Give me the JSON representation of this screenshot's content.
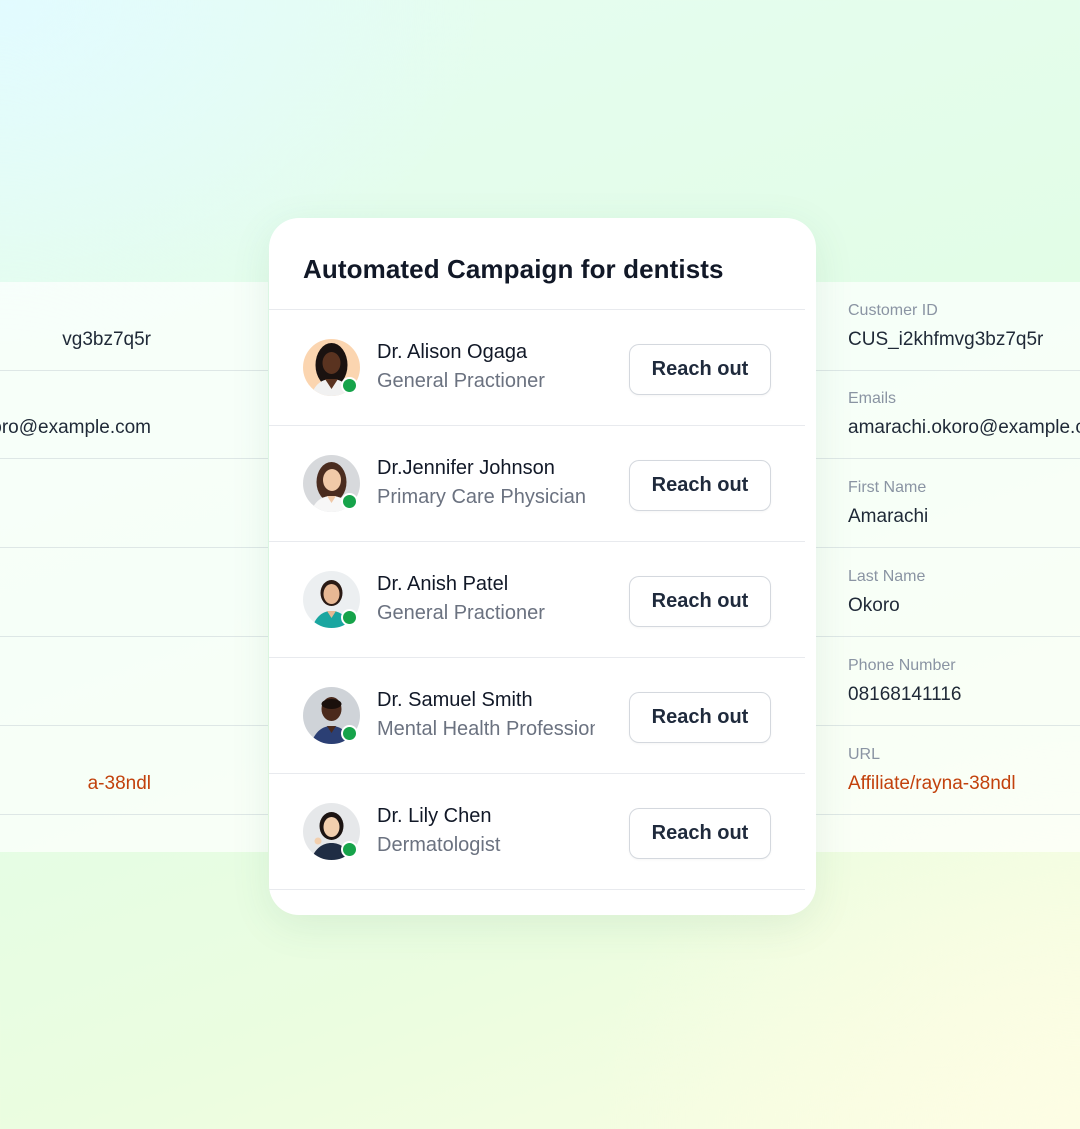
{
  "background_record": {
    "left_values": [
      "vg3bz7q5r",
      "oro@example.com",
      "",
      "",
      "",
      "a-38ndl"
    ],
    "right_fields": [
      {
        "label": "Customer ID",
        "value": "CUS_i2khfmvg3bz7q5r"
      },
      {
        "label": "Emails",
        "value": "amarachi.okoro@example.c"
      },
      {
        "label": "First Name",
        "value": "Amarachi"
      },
      {
        "label": "Last Name",
        "value": "Okoro"
      },
      {
        "label": "Phone Number",
        "value": "08168141116"
      },
      {
        "label": "URL",
        "value": "Affiliate/rayna-38ndl"
      }
    ],
    "link_color": "#c2410c"
  },
  "campaign": {
    "title": "Automated Campaign for dentists",
    "contacts": [
      {
        "name": "Dr. Alison Ogaga",
        "role": "General Practioner",
        "action": "Reach out",
        "status": "online"
      },
      {
        "name": "Dr.Jennifer Johnson",
        "role": "Primary Care Physician",
        "action": "Reach out",
        "status": "online"
      },
      {
        "name": "Dr. Anish Patel",
        "role": "General Practioner",
        "action": "Reach out",
        "status": "online"
      },
      {
        "name": "Dr. Samuel Smith",
        "role": "Mental Health Professional",
        "action": "Reach out",
        "status": "online"
      },
      {
        "name": "Dr. Lily Chen",
        "role": "Dermatologist",
        "action": "Reach out",
        "status": "online"
      }
    ],
    "status_color": "#16a34a"
  }
}
